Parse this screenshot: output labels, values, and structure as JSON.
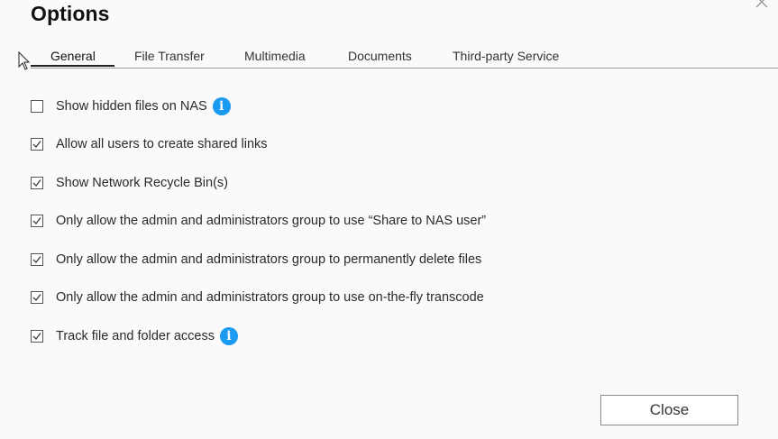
{
  "dialog": {
    "title": "Options",
    "close_icon": "close-x-icon"
  },
  "tabs": [
    {
      "label": "General",
      "active": true
    },
    {
      "label": "File Transfer",
      "active": false
    },
    {
      "label": "Multimedia",
      "active": false
    },
    {
      "label": "Documents",
      "active": false
    },
    {
      "label": "Third-party Service",
      "active": false
    }
  ],
  "options": [
    {
      "label": "Show hidden files on NAS",
      "checked": false,
      "info": true
    },
    {
      "label": "Allow all users to create shared links",
      "checked": true,
      "info": false
    },
    {
      "label": "Show Network Recycle Bin(s)",
      "checked": true,
      "info": false
    },
    {
      "label": "Only allow the admin and administrators group to use “Share to NAS user”",
      "checked": true,
      "info": false
    },
    {
      "label": "Only allow the admin and administrators group to permanently delete files",
      "checked": true,
      "info": false
    },
    {
      "label": "Only allow the admin and administrators group to use on-the-fly transcode",
      "checked": true,
      "info": false
    },
    {
      "label": "Track file and folder access",
      "checked": true,
      "info": true
    }
  ],
  "info_icon_glyph": "i",
  "footer": {
    "close_label": "Close"
  },
  "colors": {
    "info_blue": "#1a9af0",
    "background": "#fafafa"
  }
}
